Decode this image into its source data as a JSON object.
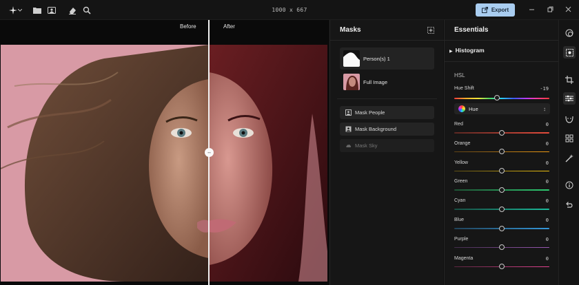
{
  "topbar": {
    "dimensions": "1000 x 667",
    "export_label": "Export",
    "icons": [
      "logo-icon",
      "chevron-down-icon",
      "folder-icon",
      "image-icon",
      "eraser-icon",
      "magnify-icon",
      "minimize-icon",
      "restore-icon",
      "close-icon"
    ]
  },
  "canvas": {
    "before_label": "Before",
    "after_label": "After"
  },
  "masks": {
    "title": "Masks",
    "items": [
      {
        "label": "Person(s) 1",
        "active": true
      },
      {
        "label": "Full Image",
        "active": false
      }
    ],
    "buttons": [
      {
        "label": "Mask People",
        "enabled": true
      },
      {
        "label": "Mask Background",
        "enabled": true
      },
      {
        "label": "Mask Sky",
        "enabled": false
      }
    ]
  },
  "essentials": {
    "title": "Essentials",
    "histogram_label": "Histogram",
    "hsl_label": "HSL",
    "hue_shift": {
      "label": "Hue Shift",
      "value": "-19",
      "level": 0.45
    },
    "mode_select": "Hue",
    "colors": [
      {
        "label": "Red",
        "value": "0",
        "level": 0.5,
        "color": "#e74c3c"
      },
      {
        "label": "Orange",
        "value": "0",
        "level": 0.5,
        "color": "#f39c12"
      },
      {
        "label": "Yellow",
        "value": "0",
        "level": 0.5,
        "color": "#f1c40f"
      },
      {
        "label": "Green",
        "value": "0",
        "level": 0.5,
        "color": "#2ecc71"
      },
      {
        "label": "Cyan",
        "value": "0",
        "level": 0.5,
        "color": "#1abc9c"
      },
      {
        "label": "Blue",
        "value": "0",
        "level": 0.5,
        "color": "#3498db"
      },
      {
        "label": "Purple",
        "value": "0",
        "level": 0.5,
        "color": "#9b59b6"
      },
      {
        "label": "Magenta",
        "value": "0",
        "level": 0.5,
        "color": "#e84393"
      }
    ]
  },
  "right_toolbar": {
    "icons": [
      "layers-icon",
      "mask-select-icon",
      "crop-icon",
      "sliders-icon",
      "face-icon",
      "grid-icon",
      "magic-icon",
      "info-icon",
      "undo-icon"
    ],
    "selected": "sliders-icon"
  },
  "colors": {
    "accent": "#a9cdf0",
    "background": "#161616",
    "photo_bg": "#d89aa5"
  }
}
